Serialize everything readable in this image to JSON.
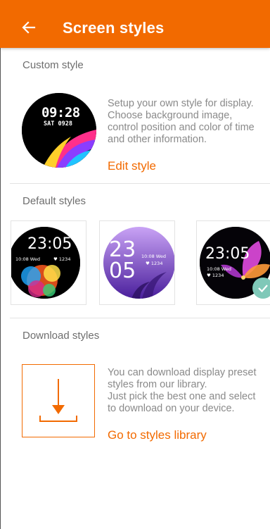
{
  "appbar": {
    "title": "Screen styles",
    "back_icon": "arrow-left-icon",
    "color": "#f26a00"
  },
  "custom_section": {
    "title": "Custom style",
    "preview_time": "09:28",
    "preview_date": "SAT 0928",
    "description": [
      "Setup your own style for display.",
      "Choose background image,",
      "control position and color of time",
      "and other information."
    ],
    "edit_link": "Edit style"
  },
  "default_section": {
    "title": "Default styles",
    "styles": [
      {
        "time": "23:05",
        "date": "10:08 Wed",
        "steps": "1234",
        "selected": false
      },
      {
        "time_hours": "23",
        "time_minutes": "05",
        "date": "10:08 Wed",
        "steps": "1234",
        "selected": false
      },
      {
        "time": "23:05",
        "date": "10:08 Wed",
        "steps": "1234",
        "selected": true
      }
    ]
  },
  "download_section": {
    "title": "Download styles",
    "icon": "download-icon",
    "description": [
      "You can download display preset",
      "styles from our library.",
      "Just pick the best one and select",
      "to download on your device."
    ],
    "library_link": "Go to styles library"
  }
}
